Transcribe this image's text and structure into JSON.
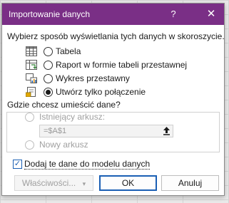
{
  "dialog": {
    "title": "Importowanie danych",
    "help_label": "?",
    "close_label": "✕",
    "prompt": "Wybierz sposób wyświetlania tych danych w skoroszycie.",
    "options": [
      {
        "label": "Tabela",
        "icon": "table-icon",
        "selected": false
      },
      {
        "label": "Raport w formie tabeli przestawnej",
        "icon": "pivot-table-icon",
        "selected": false
      },
      {
        "label": "Wykres przestawny",
        "icon": "pivot-chart-icon",
        "selected": false
      },
      {
        "label": "Utwórz tylko połączenie",
        "icon": "connection-only-icon",
        "selected": true
      }
    ],
    "location_prompt": "Gdzie chcesz umieścić dane?",
    "existing_sheet_label": "Istniejący arkusz:",
    "existing_sheet_ref": "=$A$1",
    "collapse_icon": "collapse-dialog-icon",
    "new_sheet_label": "Nowy arkusz",
    "add_to_model_label": "Dodaj te dane do modelu danych",
    "add_to_model_checked": true,
    "properties_label": "Właściwości...",
    "ok_label": "OK",
    "cancel_label": "Anuluj",
    "accent_color": "#7a2f86",
    "focus_color": "#1a5fb4"
  }
}
